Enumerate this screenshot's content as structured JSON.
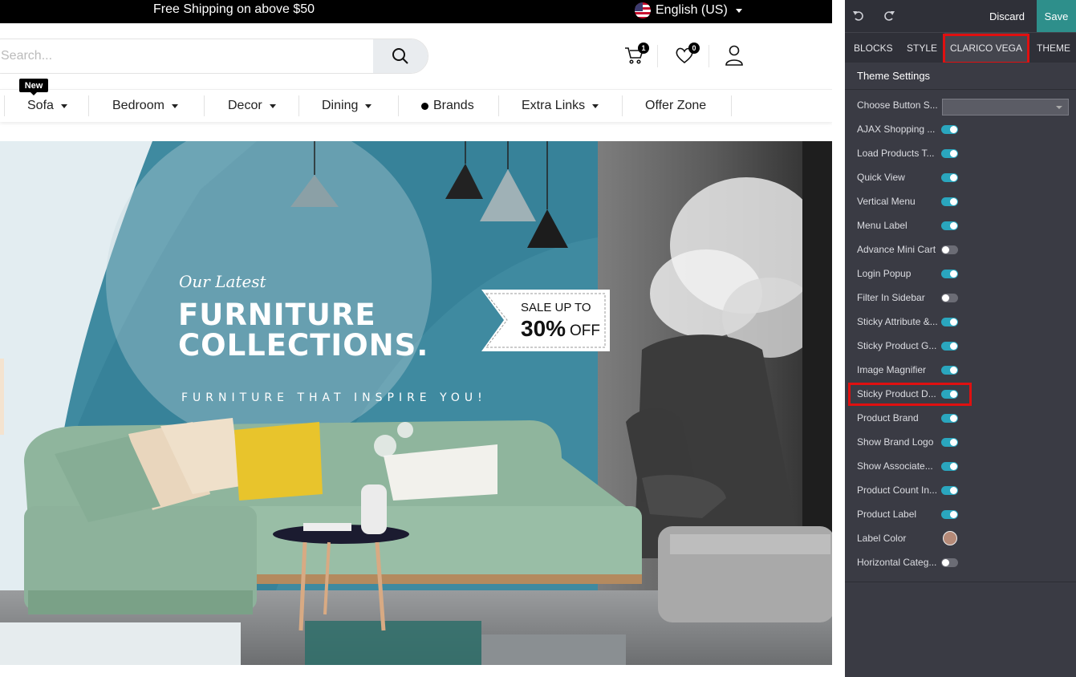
{
  "topbar": {
    "promo": "Free Shipping on above $50",
    "language": "English (US)"
  },
  "search": {
    "placeholder": "Search..."
  },
  "header": {
    "cart_count": "1",
    "wishlist_count": "0"
  },
  "menu": {
    "badge": "New",
    "items": [
      {
        "label": "Sofa"
      },
      {
        "label": "Bedroom"
      },
      {
        "label": "Decor"
      },
      {
        "label": "Dining"
      },
      {
        "label": "Brands"
      },
      {
        "label": "Extra Links"
      },
      {
        "label": "Offer Zone"
      }
    ]
  },
  "banner": {
    "subtitle": "Our Latest",
    "title_line1": "FURNITURE",
    "title_line2": "COLLECTIONS.",
    "tagline": "FURNITURE THAT INSPIRE YOU!",
    "sale_top": "SALE UP TO",
    "sale_percent": "30%",
    "sale_off": "OFF"
  },
  "editor": {
    "discard_label": "Discard",
    "save_label": "Save",
    "tabs": [
      {
        "label": "BLOCKS"
      },
      {
        "label": "STYLE"
      },
      {
        "label": "CLARICO VEGA"
      },
      {
        "label": "THEME"
      }
    ],
    "section_title": "Theme Settings",
    "options": [
      {
        "label": "Choose Button S...",
        "type": "select",
        "value": ""
      },
      {
        "label": "AJAX Shopping ...",
        "type": "toggle",
        "on": true
      },
      {
        "label": "Load Products T...",
        "type": "toggle",
        "on": true
      },
      {
        "label": "Quick View",
        "type": "toggle",
        "on": true
      },
      {
        "label": "Vertical Menu",
        "type": "toggle",
        "on": true
      },
      {
        "label": "Menu Label",
        "type": "toggle",
        "on": true
      },
      {
        "label": "Advance Mini Cart",
        "type": "toggle",
        "on": false
      },
      {
        "label": "Login Popup",
        "type": "toggle",
        "on": true
      },
      {
        "label": "Filter In Sidebar",
        "type": "toggle",
        "on": false
      },
      {
        "label": "Sticky Attribute &...",
        "type": "toggle",
        "on": true
      },
      {
        "label": "Sticky Product G...",
        "type": "toggle",
        "on": true
      },
      {
        "label": "Image Magnifier",
        "type": "toggle",
        "on": true
      },
      {
        "label": "Sticky Product D...",
        "type": "toggle",
        "on": true
      },
      {
        "label": "Product Brand",
        "type": "toggle",
        "on": true
      },
      {
        "label": "Show Brand Logo",
        "type": "toggle",
        "on": true
      },
      {
        "label": "Show Associate...",
        "type": "toggle",
        "on": true
      },
      {
        "label": "Product Count In...",
        "type": "toggle",
        "on": true
      },
      {
        "label": "Product Label",
        "type": "toggle",
        "on": true
      },
      {
        "label": "Label Color",
        "type": "color",
        "value": "#b58a78"
      },
      {
        "label": "Horizontal Categ...",
        "type": "toggle",
        "on": false
      }
    ]
  },
  "colors": {
    "accent": "#2e8f8b",
    "toggle_on": "#2aa6be",
    "highlight": "#e01010",
    "panel_bg": "#3a3b44"
  }
}
